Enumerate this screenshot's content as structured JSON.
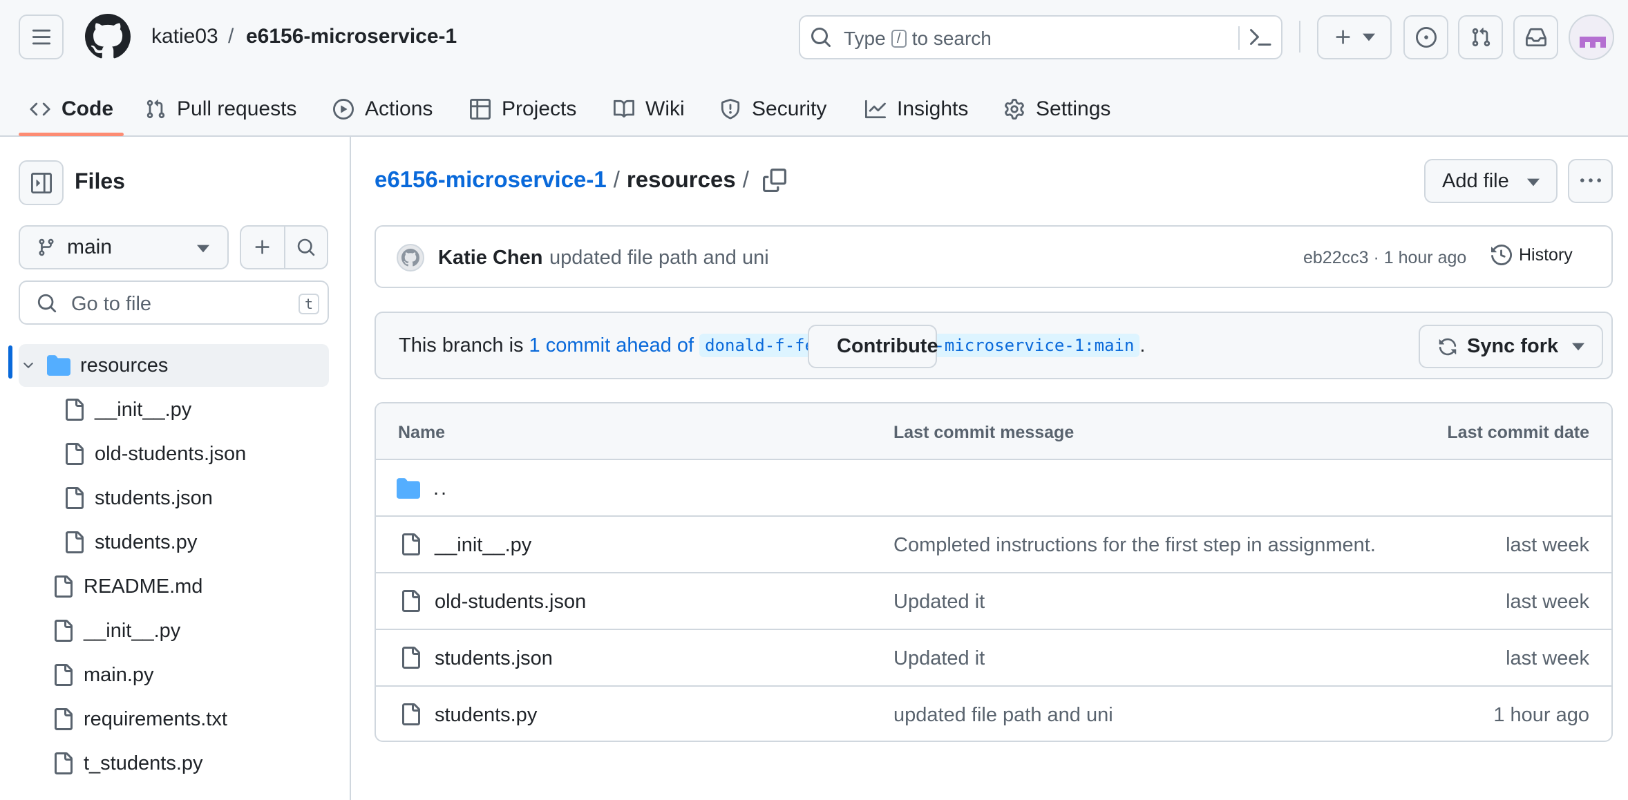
{
  "header": {
    "owner": "katie03",
    "separator": "/",
    "repo": "e6156-microservice-1",
    "search_prefix": "Type",
    "search_key": "/",
    "search_suffix": "to search"
  },
  "tabs": [
    {
      "label": "Code",
      "icon": "code-icon"
    },
    {
      "label": "Pull requests",
      "icon": "git-pull-request-icon"
    },
    {
      "label": "Actions",
      "icon": "play-icon"
    },
    {
      "label": "Projects",
      "icon": "table-icon"
    },
    {
      "label": "Wiki",
      "icon": "book-icon"
    },
    {
      "label": "Security",
      "icon": "shield-icon"
    },
    {
      "label": "Insights",
      "icon": "graph-icon"
    },
    {
      "label": "Settings",
      "icon": "gear-icon"
    }
  ],
  "sidebar": {
    "title": "Files",
    "branch": "main",
    "goto_placeholder": "Go to file",
    "goto_shortcut": "t",
    "tree": [
      {
        "name": "resources",
        "type": "folder",
        "depth": 0,
        "expanded": true,
        "selected": true
      },
      {
        "name": "__init__.py",
        "type": "file",
        "depth": 1
      },
      {
        "name": "old-students.json",
        "type": "file",
        "depth": 1
      },
      {
        "name": "students.json",
        "type": "file",
        "depth": 1
      },
      {
        "name": "students.py",
        "type": "file",
        "depth": 1
      },
      {
        "name": "README.md",
        "type": "file",
        "depth": 0
      },
      {
        "name": "__init__.py",
        "type": "file",
        "depth": 0
      },
      {
        "name": "main.py",
        "type": "file",
        "depth": 0
      },
      {
        "name": "requirements.txt",
        "type": "file",
        "depth": 0
      },
      {
        "name": "t_students.py",
        "type": "file",
        "depth": 0
      }
    ]
  },
  "main": {
    "path_repo": "e6156-microservice-1",
    "path_sep": "/",
    "path_current": "resources",
    "path_trailing": "/",
    "add_file_label": "Add file",
    "commit": {
      "author": "Katie Chen",
      "message": "updated file path and uni",
      "meta": "eb22cc3 · 1 hour ago",
      "history_label": "History"
    },
    "branch_status": {
      "prefix": "This branch is",
      "link": "1 commit ahead of",
      "upstream": "donald-f-ferguson/e6156-microservice-1:main",
      "suffix": ".",
      "contribute_label": "Contribute",
      "sync_label": "Sync fork"
    },
    "table": {
      "headers": [
        "Name",
        "Last commit message",
        "Last commit date"
      ],
      "rows": [
        {
          "name": "..",
          "type": "parent",
          "message": "",
          "date": ""
        },
        {
          "name": "__init__.py",
          "type": "file",
          "message": "Completed instructions for the first step in assignment.",
          "date": "last week"
        },
        {
          "name": "old-students.json",
          "type": "file",
          "message": "Updated it",
          "date": "last week"
        },
        {
          "name": "students.json",
          "type": "file",
          "message": "Updated it",
          "date": "last week"
        },
        {
          "name": "students.py",
          "type": "file",
          "message": "updated file path and uni",
          "date": "1 hour ago"
        }
      ]
    }
  },
  "colors": {
    "accent": "#0969da",
    "tab_underline": "#fd8c73",
    "folder": "#54aeff",
    "border": "#d0d7de",
    "muted": "#59636e"
  }
}
